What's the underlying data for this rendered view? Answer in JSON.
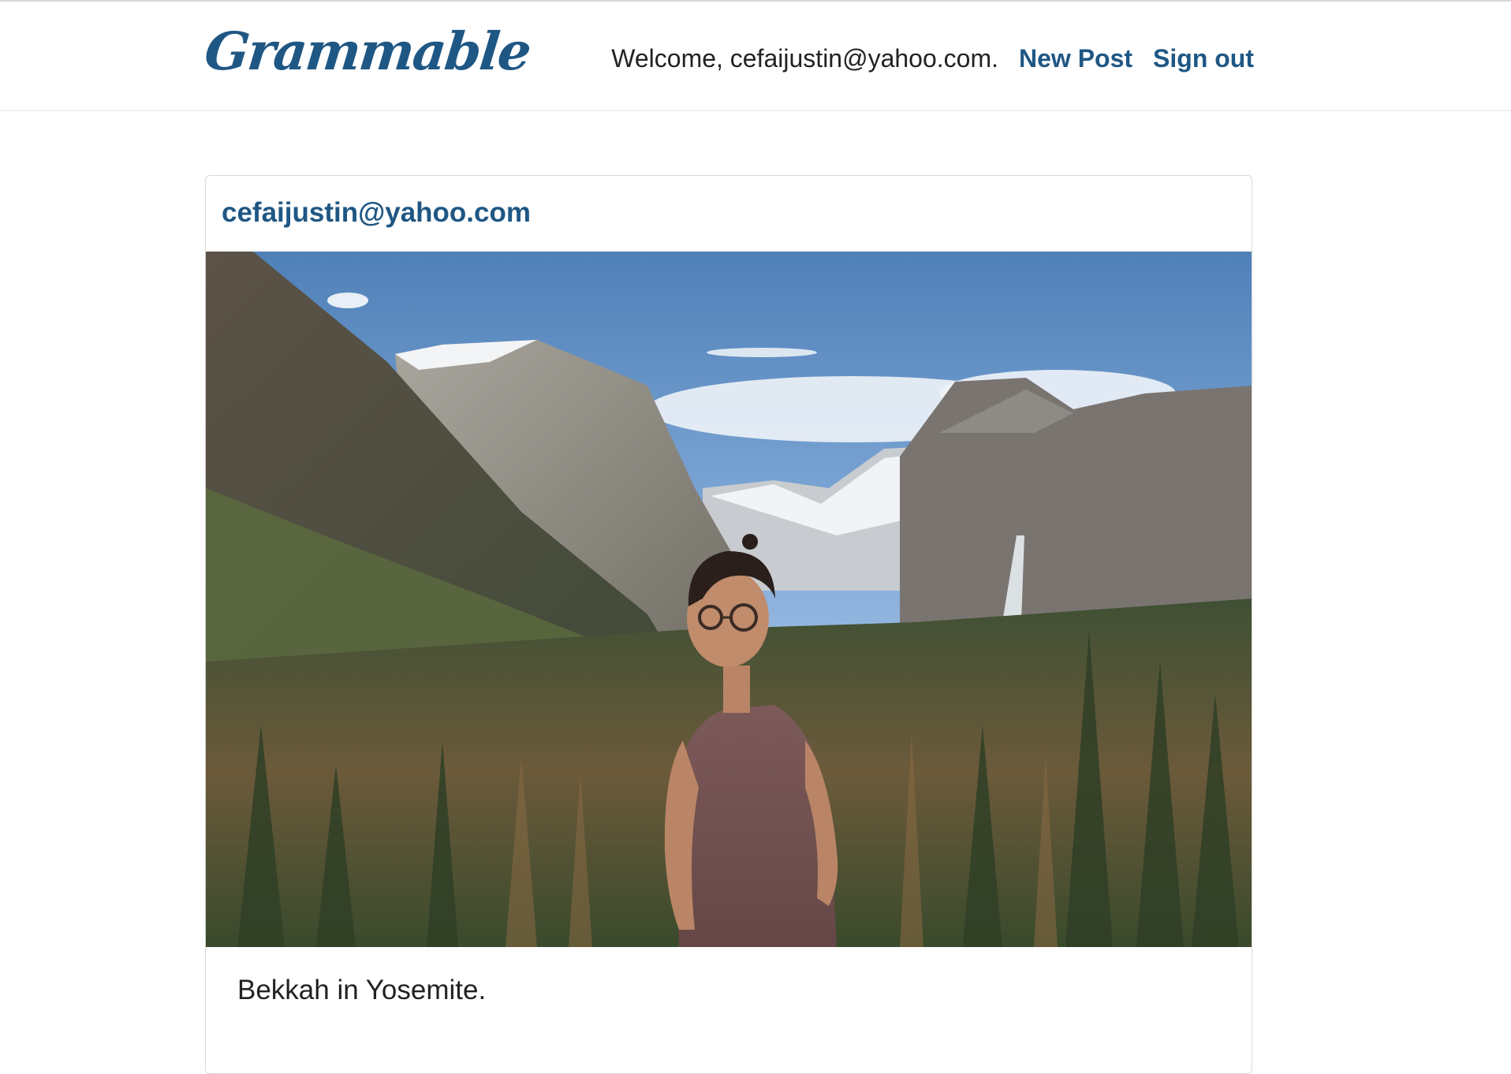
{
  "header": {
    "brand": "Grammable",
    "welcome": "Welcome, cefaijustin@yahoo.com.",
    "new_post_label": "New Post",
    "sign_out_label": "Sign out"
  },
  "post": {
    "author": "cefaijustin@yahoo.com",
    "caption": "Bekkah in Yosemite.",
    "image_subject": "person-in-yosemite-valley-photo"
  },
  "colors": {
    "brand": "#1f5784",
    "text": "#222222",
    "border": "#d9d9d9"
  }
}
